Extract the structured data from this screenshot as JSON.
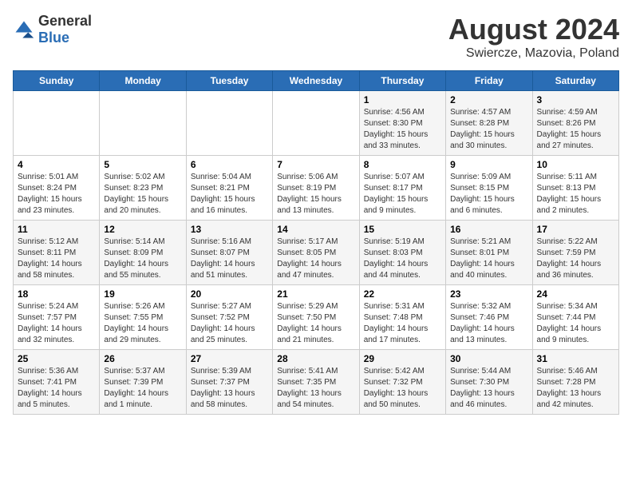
{
  "header": {
    "logo": {
      "general": "General",
      "blue": "Blue"
    },
    "title": "August 2024",
    "subtitle": "Swiercze, Mazovia, Poland"
  },
  "calendar": {
    "days_of_week": [
      "Sunday",
      "Monday",
      "Tuesday",
      "Wednesday",
      "Thursday",
      "Friday",
      "Saturday"
    ],
    "weeks": [
      [
        {
          "day": "",
          "info": ""
        },
        {
          "day": "",
          "info": ""
        },
        {
          "day": "",
          "info": ""
        },
        {
          "day": "",
          "info": ""
        },
        {
          "day": "1",
          "info": "Sunrise: 4:56 AM\nSunset: 8:30 PM\nDaylight: 15 hours\nand 33 minutes."
        },
        {
          "day": "2",
          "info": "Sunrise: 4:57 AM\nSunset: 8:28 PM\nDaylight: 15 hours\nand 30 minutes."
        },
        {
          "day": "3",
          "info": "Sunrise: 4:59 AM\nSunset: 8:26 PM\nDaylight: 15 hours\nand 27 minutes."
        }
      ],
      [
        {
          "day": "4",
          "info": "Sunrise: 5:01 AM\nSunset: 8:24 PM\nDaylight: 15 hours\nand 23 minutes."
        },
        {
          "day": "5",
          "info": "Sunrise: 5:02 AM\nSunset: 8:23 PM\nDaylight: 15 hours\nand 20 minutes."
        },
        {
          "day": "6",
          "info": "Sunrise: 5:04 AM\nSunset: 8:21 PM\nDaylight: 15 hours\nand 16 minutes."
        },
        {
          "day": "7",
          "info": "Sunrise: 5:06 AM\nSunset: 8:19 PM\nDaylight: 15 hours\nand 13 minutes."
        },
        {
          "day": "8",
          "info": "Sunrise: 5:07 AM\nSunset: 8:17 PM\nDaylight: 15 hours\nand 9 minutes."
        },
        {
          "day": "9",
          "info": "Sunrise: 5:09 AM\nSunset: 8:15 PM\nDaylight: 15 hours\nand 6 minutes."
        },
        {
          "day": "10",
          "info": "Sunrise: 5:11 AM\nSunset: 8:13 PM\nDaylight: 15 hours\nand 2 minutes."
        }
      ],
      [
        {
          "day": "11",
          "info": "Sunrise: 5:12 AM\nSunset: 8:11 PM\nDaylight: 14 hours\nand 58 minutes."
        },
        {
          "day": "12",
          "info": "Sunrise: 5:14 AM\nSunset: 8:09 PM\nDaylight: 14 hours\nand 55 minutes."
        },
        {
          "day": "13",
          "info": "Sunrise: 5:16 AM\nSunset: 8:07 PM\nDaylight: 14 hours\nand 51 minutes."
        },
        {
          "day": "14",
          "info": "Sunrise: 5:17 AM\nSunset: 8:05 PM\nDaylight: 14 hours\nand 47 minutes."
        },
        {
          "day": "15",
          "info": "Sunrise: 5:19 AM\nSunset: 8:03 PM\nDaylight: 14 hours\nand 44 minutes."
        },
        {
          "day": "16",
          "info": "Sunrise: 5:21 AM\nSunset: 8:01 PM\nDaylight: 14 hours\nand 40 minutes."
        },
        {
          "day": "17",
          "info": "Sunrise: 5:22 AM\nSunset: 7:59 PM\nDaylight: 14 hours\nand 36 minutes."
        }
      ],
      [
        {
          "day": "18",
          "info": "Sunrise: 5:24 AM\nSunset: 7:57 PM\nDaylight: 14 hours\nand 32 minutes."
        },
        {
          "day": "19",
          "info": "Sunrise: 5:26 AM\nSunset: 7:55 PM\nDaylight: 14 hours\nand 29 minutes."
        },
        {
          "day": "20",
          "info": "Sunrise: 5:27 AM\nSunset: 7:52 PM\nDaylight: 14 hours\nand 25 minutes."
        },
        {
          "day": "21",
          "info": "Sunrise: 5:29 AM\nSunset: 7:50 PM\nDaylight: 14 hours\nand 21 minutes."
        },
        {
          "day": "22",
          "info": "Sunrise: 5:31 AM\nSunset: 7:48 PM\nDaylight: 14 hours\nand 17 minutes."
        },
        {
          "day": "23",
          "info": "Sunrise: 5:32 AM\nSunset: 7:46 PM\nDaylight: 14 hours\nand 13 minutes."
        },
        {
          "day": "24",
          "info": "Sunrise: 5:34 AM\nSunset: 7:44 PM\nDaylight: 14 hours\nand 9 minutes."
        }
      ],
      [
        {
          "day": "25",
          "info": "Sunrise: 5:36 AM\nSunset: 7:41 PM\nDaylight: 14 hours\nand 5 minutes."
        },
        {
          "day": "26",
          "info": "Sunrise: 5:37 AM\nSunset: 7:39 PM\nDaylight: 14 hours\nand 1 minute."
        },
        {
          "day": "27",
          "info": "Sunrise: 5:39 AM\nSunset: 7:37 PM\nDaylight: 13 hours\nand 58 minutes."
        },
        {
          "day": "28",
          "info": "Sunrise: 5:41 AM\nSunset: 7:35 PM\nDaylight: 13 hours\nand 54 minutes."
        },
        {
          "day": "29",
          "info": "Sunrise: 5:42 AM\nSunset: 7:32 PM\nDaylight: 13 hours\nand 50 minutes."
        },
        {
          "day": "30",
          "info": "Sunrise: 5:44 AM\nSunset: 7:30 PM\nDaylight: 13 hours\nand 46 minutes."
        },
        {
          "day": "31",
          "info": "Sunrise: 5:46 AM\nSunset: 7:28 PM\nDaylight: 13 hours\nand 42 minutes."
        }
      ]
    ]
  }
}
